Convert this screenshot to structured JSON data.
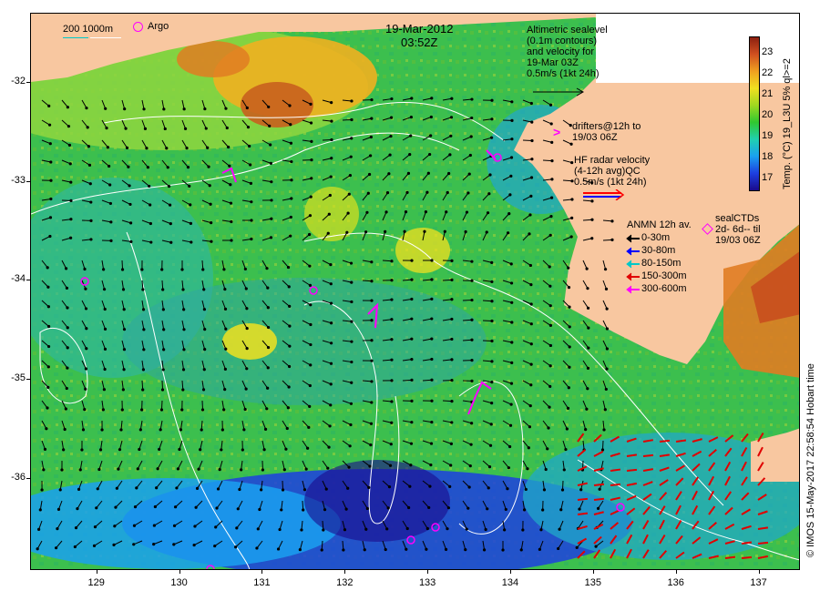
{
  "title": {
    "date": "19-Mar-2012",
    "time": "03:52Z"
  },
  "scale_legend": {
    "depth_a": "200",
    "depth_b": "1000m"
  },
  "argo_label": "Argo",
  "sealevel_note": "Altimetric sealevel\n(0.1m contours)\nand velocity for\n19-Mar 03Z\n0.5m/s (1kt 24h)",
  "drifters_note": "drifters@12h to\n19/03 06Z",
  "hf_radar_note": "HF radar velocity\n(4-12h avg)QC\n0.5m/s (1kt 24h)",
  "anmn_legend": {
    "title": "ANMN 12h av.",
    "items": [
      {
        "label": "0-30m",
        "color": "#000000"
      },
      {
        "label": "30-80m",
        "color": "#0000ff"
      },
      {
        "label": "80-150m",
        "color": "#00c8c8"
      },
      {
        "label": "150-300m",
        "color": "#e00000"
      },
      {
        "label": "300-600m",
        "color": "#ff00ff"
      }
    ]
  },
  "seal_note": "sealCTDs\n2d- 6d-- til\n19/03 06Z",
  "colorbar": {
    "unit_label": "Temp. (°C) 19_L3U 5% ql>=2",
    "ticks": [
      "23",
      "22",
      "21",
      "20",
      "19",
      "18",
      "17"
    ],
    "min": 16.5,
    "max": 23.8,
    "colors": [
      "#1a0a8c",
      "#1d3fe0",
      "#1aa0f0",
      "#20d0b0",
      "#30c830",
      "#9fd820",
      "#f0e020",
      "#f0a020",
      "#d05020",
      "#8c2010"
    ]
  },
  "credit": "© IMOS 15-May-2017 22:58:54 Hobart time",
  "axes": {
    "y_ticks": [
      "-32",
      "-33",
      "-34",
      "-35",
      "-36"
    ],
    "x_ticks": [
      "129",
      "130",
      "131",
      "132",
      "133",
      "134",
      "135",
      "136",
      "137"
    ],
    "lat_range": [
      -36.93,
      -31.3
    ],
    "lon_range": [
      128.2,
      137.5
    ]
  },
  "colors": {
    "land": "#f8c7a0",
    "contour": "#ffffff",
    "drifter": "#ff00ff",
    "hf_arrow": "#ff0000"
  }
}
